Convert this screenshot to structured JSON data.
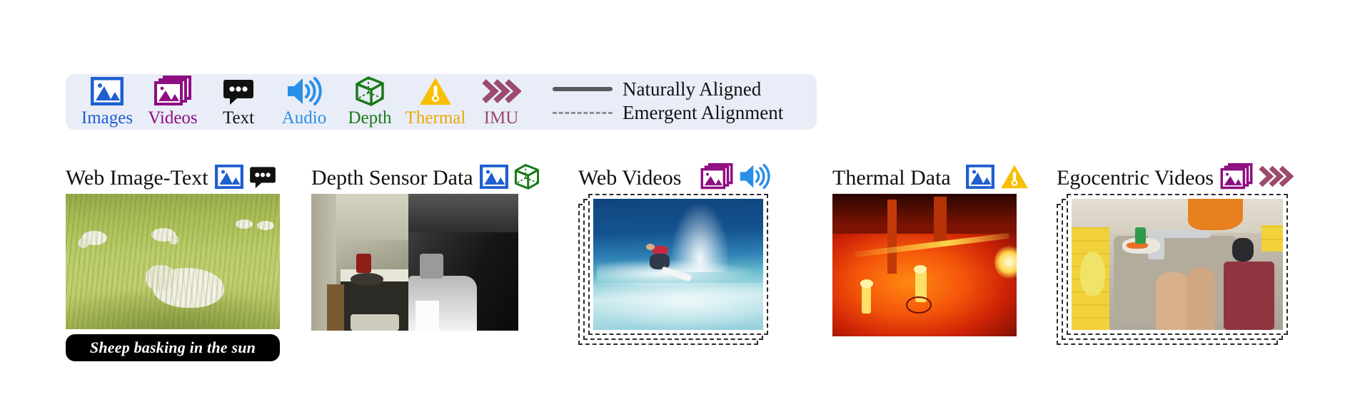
{
  "legend": {
    "modalities": [
      {
        "id": "images",
        "label": "Images",
        "color": "#1f5fd0",
        "icon": "image-icon"
      },
      {
        "id": "videos",
        "label": "Videos",
        "color": "#8e0e82",
        "icon": "video-stack-icon"
      },
      {
        "id": "text",
        "label": "Text",
        "color": "#111111",
        "icon": "speech-bubble-icon"
      },
      {
        "id": "audio",
        "label": "Audio",
        "color": "#2a8fe8",
        "icon": "speaker-icon"
      },
      {
        "id": "depth",
        "label": "Depth",
        "color": "#1a7a1a",
        "icon": "cube-icon"
      },
      {
        "id": "thermal",
        "label": "Thermal",
        "color": "#e8a900",
        "icon": "thermometer-triangle-icon"
      },
      {
        "id": "imu",
        "label": "IMU",
        "color": "#9c4a6e",
        "icon": "chevrons-icon"
      }
    ],
    "keys": [
      {
        "style": "solid",
        "label": "Naturally Aligned"
      },
      {
        "style": "dashed",
        "label": "Emergent Alignment"
      }
    ],
    "background": "#e9edf7"
  },
  "panels": [
    {
      "id": "web-image-text",
      "title": "Web Image-Text",
      "icons": [
        "image-icon",
        "speech-bubble-icon"
      ],
      "caption": "Sheep basking in the sun",
      "media": "sheep-field-photo",
      "stacked": false
    },
    {
      "id": "depth-sensor-data",
      "title": "Depth Sensor Data",
      "icons": [
        "image-icon",
        "cube-icon"
      ],
      "media": "kitchen-rgb-depth-split",
      "stacked": false
    },
    {
      "id": "web-videos",
      "title": "Web Videos",
      "icons": [
        "video-stack-icon",
        "speaker-icon"
      ],
      "media": "surfer-wave-video",
      "stacked": true
    },
    {
      "id": "thermal-data",
      "title": "Thermal Data",
      "icons": [
        "image-icon",
        "thermometer-triangle-icon"
      ],
      "media": "thermal-street-scene",
      "stacked": false
    },
    {
      "id": "egocentric-videos",
      "title": "Egocentric Videos",
      "icons": [
        "video-stack-icon",
        "chevrons-icon"
      ],
      "media": "kitchen-sink-egocentric-video",
      "stacked": true
    }
  ]
}
